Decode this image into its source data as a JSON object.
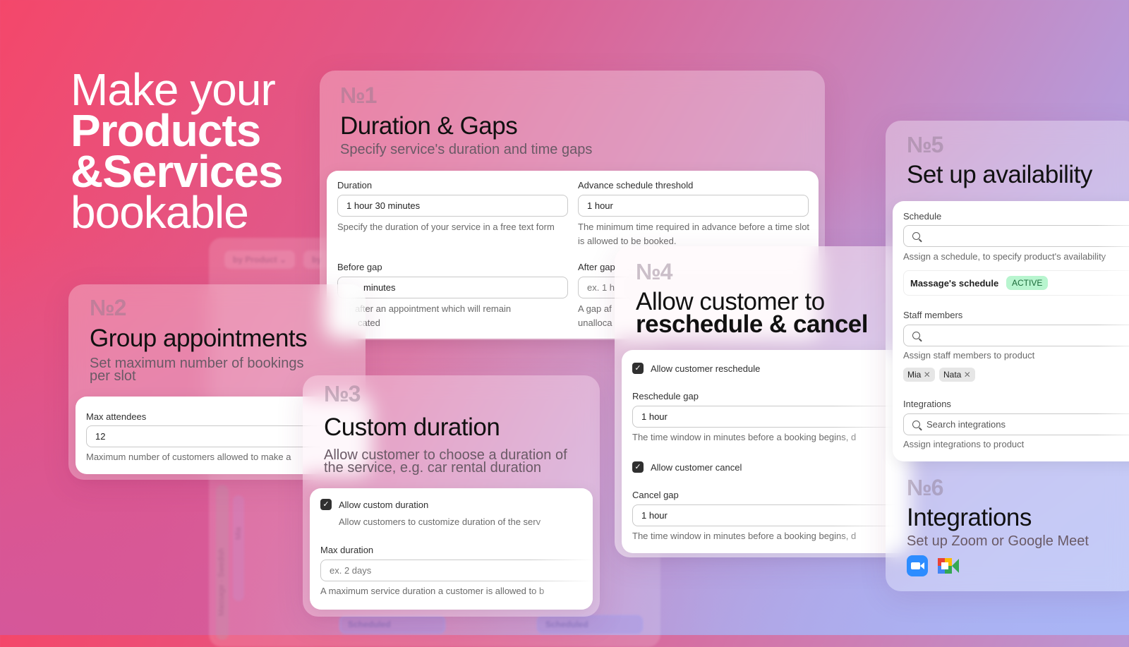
{
  "headline": {
    "line1": "Make your",
    "line2": "Products",
    "line3": "&Services",
    "line4": "bookable"
  },
  "background_calendar": {
    "filter1": "by Product",
    "filter2": "by",
    "resource": "Massage - Swedish",
    "staff": "Mia",
    "status1": "Scheduled",
    "status2": "Scheduled"
  },
  "card1": {
    "number": "№1",
    "title": "Duration & Gaps",
    "subtitle": "Specify service's duration and time gaps",
    "duration": {
      "label": "Duration",
      "value": "1 hour 30 minutes",
      "help": "Specify the duration of your service in a free text form"
    },
    "advance": {
      "label": "Advance schedule threshold",
      "value": "1 hour",
      "help": "The minimum time required in advance before a time slot is allowed to be booked."
    },
    "before_gap": {
      "label": "Before gap",
      "value": "minutes",
      "help": "after an appointment which will remain",
      "help2": "cated"
    },
    "after_gap": {
      "label": "After gap",
      "placeholder": "ex. 1 h",
      "help": "A gap af",
      "help2": "unalloca"
    }
  },
  "card2": {
    "number": "№2",
    "title": "Group appointments",
    "subtitle": "Set maximum number of bookings per slot",
    "max_attendees": {
      "label": "Max attendees",
      "value": "12",
      "help": "Maximum number of customers allowed to make a"
    }
  },
  "card3": {
    "number": "№3",
    "title": "Custom duration",
    "subtitle": "Allow customer to choose a duration of the service, e.g. car rental duration",
    "allow_custom": {
      "label": "Allow custom duration",
      "checked": true,
      "help": "Allow customers to customize duration of the serv"
    },
    "max_duration": {
      "label": "Max duration",
      "placeholder": "ex. 2 days",
      "help": "A maximum service duration a customer is allowed to b"
    }
  },
  "card4": {
    "number": "№4",
    "title_line1": "Allow customer to",
    "title_line2": "reschedule & cancel",
    "allow_reschedule": {
      "label": "Allow customer reschedule",
      "checked": true
    },
    "reschedule_gap": {
      "label": "Reschedule gap",
      "value": "1 hour",
      "help": "The time window in minutes before a booking begins, d"
    },
    "allow_cancel": {
      "label": "Allow customer cancel",
      "checked": true
    },
    "cancel_gap": {
      "label": "Cancel gap",
      "value": "1 hour",
      "help": "The time window in minutes before a booking begins, d"
    }
  },
  "card5": {
    "number": "№5",
    "title": "Set up availability",
    "schedule": {
      "label": "Schedule",
      "help": "Assign a schedule, to specify product's availability",
      "selected": "Massage's schedule",
      "badge": "ACTIVE"
    },
    "staff": {
      "label": "Staff members",
      "help": "Assign staff members to product",
      "tags": [
        "Mia",
        "Nata"
      ]
    },
    "integrations": {
      "label": "Integrations",
      "placeholder": "Search integrations",
      "help": "Assign integrations to product"
    }
  },
  "card6": {
    "number": "№6",
    "title": "Integrations",
    "subtitle": "Set up Zoom or Google Meet",
    "icons": [
      "zoom-icon",
      "google-meet-icon"
    ]
  },
  "colors": {
    "badge_bg": "#b8f5cf",
    "badge_text": "#1c6b3a",
    "zoom": "#2d8cff",
    "checkbox": "#303030"
  }
}
